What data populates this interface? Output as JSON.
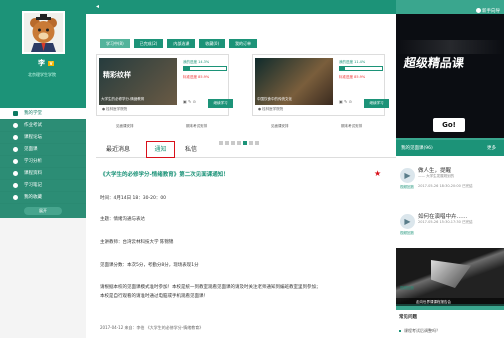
{
  "user": {
    "name": "李",
    "vip": "V",
    "school": "北京理学生学院"
  },
  "nav": [
    {
      "label": "我的学堂",
      "active": true
    },
    {
      "label": "作业考试",
      "active": false
    },
    {
      "label": "课程论坛",
      "active": false
    },
    {
      "label": "见面课",
      "active": false
    },
    {
      "label": "学习分析",
      "active": false
    },
    {
      "label": "课程资料",
      "active": false
    },
    {
      "label": "学习笔记",
      "active": false
    },
    {
      "label": "我的收藏",
      "active": false
    }
  ],
  "expand_label": "展开",
  "tabs": [
    {
      "label": "学习中(8)",
      "active": true
    },
    {
      "label": "已完成(2)",
      "active": false
    },
    {
      "label": "内部选课",
      "active": false
    },
    {
      "label": "收藏(0)",
      "active": false
    },
    {
      "label": "我的订单",
      "active": false
    }
  ],
  "courses": [
    {
      "title_art": "精彩纹样",
      "caption": "大学生的必修学分-情绪教育",
      "school": "桂林医学院院",
      "progress_label": "我的进度 14.3%",
      "progress": 0.143,
      "standard": "标准进度 85.9%",
      "study_btn": "继续学习",
      "controls": [
        "见面课安排",
        "期末考试安排"
      ]
    },
    {
      "title_art": "",
      "caption": "中国饮食中的传统文化",
      "school": "桂林医学院院",
      "progress_label": "我的进度 11.4%",
      "progress": 0.114,
      "standard": "标准进度 85.9%",
      "study_btn": "继续学习",
      "controls": [
        "见面课安排",
        "期末考试安排"
      ]
    }
  ],
  "carousel_dots": 7,
  "carousel_active": 4,
  "message_tabs": [
    "最近消息",
    "通知",
    "私信"
  ],
  "notice": {
    "title": "《大学生的必修学分-情绪教育》第二次见面课通知！",
    "lines": [
      "时间：4月14日 18：30-20：00",
      "主题：情绪沟通与表达",
      "主讲教师：台湾云林科技大学 陈锦锦",
      "见面课分数：本次5分，考勤分8分，现场表现1分",
      "请根据本校的见面课模式准时参加！本校是统一到教室观看见面课的请及时关注老师通知到编班教室里到参加；",
      "本校是自行观看的请准时通过电脑或手机观看见面课！"
    ],
    "footer": "2017-04-12 来自：李伯  《大学生的必修学分-情绪教育》"
  },
  "help_label": "新手向导",
  "banner": {
    "title": "超级精品课",
    "go": "Go!"
  },
  "live": {
    "header": "我的见面课(96)",
    "more": "更多",
    "items": [
      {
        "tag": "视频回放",
        "title": "做人生，提醒",
        "subtitle": "—— 大学生发展规划的",
        "meta": "2017-05-26 18:30-20:00 已完结"
      },
      {
        "tag": "视频回放",
        "title": "如何在演唱中卉……",
        "subtitle": "2017-05-26 15:30-17:30 已完结",
        "meta": ""
      }
    ],
    "video_tag": "视频回放",
    "video_caption": "走向世界课课程报告会"
  },
  "faq": {
    "header": "常见问题",
    "item": "课程考试后调整吗？"
  }
}
